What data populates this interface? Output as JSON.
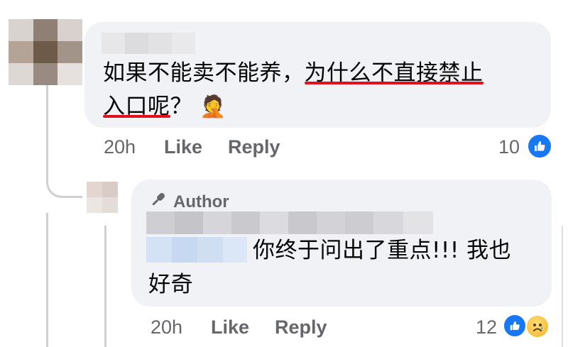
{
  "colors": {
    "bubble": "#f0f2f5",
    "meta_text": "#65676b",
    "like_blue": "#1877f2",
    "underline_red": "#e0111c"
  },
  "comment": {
    "text_part1": "如果不能卖不能养，",
    "text_highlight1": "为什么不直接禁止",
    "text_highlight2": "入口呢",
    "text_part2": "？",
    "emoji": "🤦",
    "time": "20h",
    "like_label": "Like",
    "reply_label": "Reply",
    "reaction_count": "10",
    "reaction_icon": "thumbs-up-icon"
  },
  "reply": {
    "badge_icon": "microphone-icon",
    "badge_label": "Author",
    "text": "你终于问出了重点!!! 我也",
    "text_line2": "好奇",
    "time": "20h",
    "like_label": "Like",
    "reply_label": "Reply",
    "reaction_count": "12",
    "reaction_icons": [
      "thumbs-up-icon",
      "sad-face-icon"
    ]
  }
}
